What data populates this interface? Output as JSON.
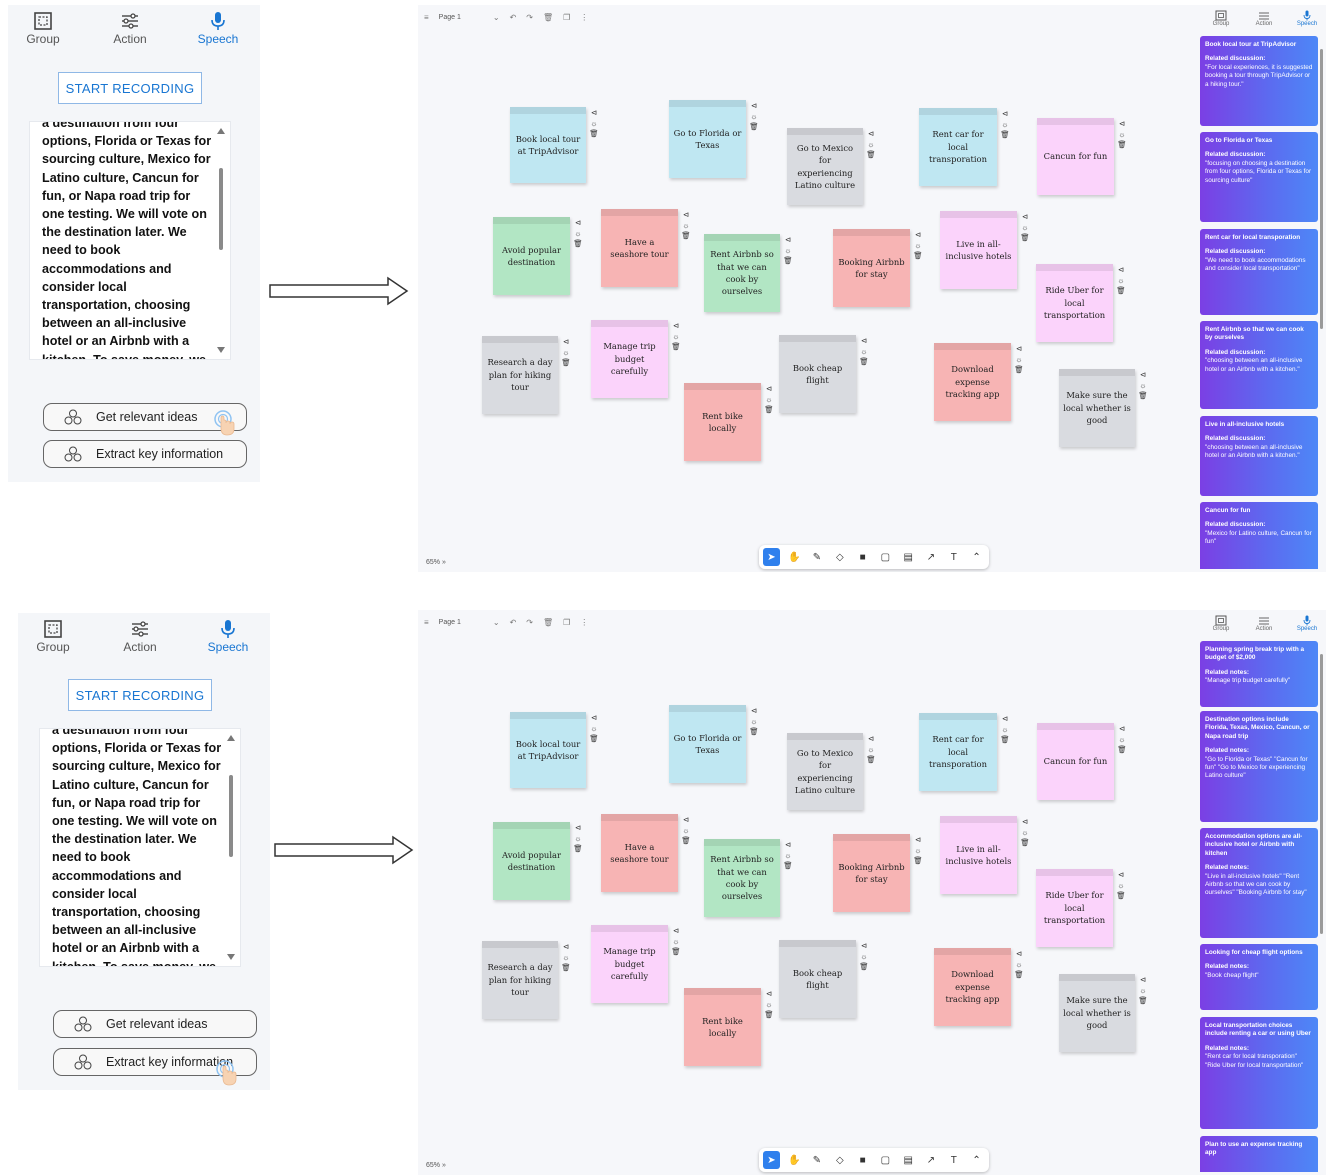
{
  "panels": [
    {
      "tabs": [
        {
          "label": "Group",
          "icon": "group-icon"
        },
        {
          "label": "Action",
          "icon": "sliders-icon"
        },
        {
          "label": "Speech",
          "icon": "microphone-icon"
        }
      ],
      "active_tab": "Speech",
      "record_label": "START RECORDING",
      "transcript": "a destination from four options, Florida or Texas for sourcing culture, Mexico for Latino culture, Cancun for fun, or Napa road trip for one testing. We will vote on the destination later. We need to book accommodations and consider local transportation, choosing between an all-inclusive hotel or an Airbnb with a kitchen. To save money, we",
      "buttons": [
        "Get relevant ideas",
        "Extract key information"
      ],
      "pressed_button": 0
    },
    {
      "tabs": [
        {
          "label": "Group",
          "icon": "group-icon"
        },
        {
          "label": "Action",
          "icon": "sliders-icon"
        },
        {
          "label": "Speech",
          "icon": "microphone-icon"
        }
      ],
      "active_tab": "Speech",
      "record_label": "START RECORDING",
      "transcript": "a destination from four options, Florida or Texas for sourcing culture, Mexico for Latino culture, Cancun for fun, or Napa road trip for one testing. We will vote on the destination later. We need to book accommodations and consider local transportation, choosing between an all-inclusive hotel or an Airbnb with a kitchen. To save money, we",
      "buttons": [
        "Get relevant ideas",
        "Extract key information"
      ],
      "pressed_button": 1
    }
  ],
  "board": {
    "page_label": "Page 1",
    "zoom_label": "65%",
    "toolbar_tools": [
      "select-icon",
      "hand-icon",
      "pen-icon",
      "eraser-icon",
      "sticky-note-icon",
      "shape-icon",
      "frame-icon",
      "arrow-icon",
      "text-icon",
      "chevron-up-icon"
    ],
    "side_tabs": [
      "Group",
      "Action",
      "Speech"
    ],
    "notes": [
      {
        "text": "Book local tour at TripAdvisor",
        "color": "#bfe7f2"
      },
      {
        "text": "Go to Florida or Texas",
        "color": "#bfe7f2"
      },
      {
        "text": "Go to Mexico for experiencing Latino culture",
        "color": "#d9dbe0"
      },
      {
        "text": "Rent car for local transporation",
        "color": "#bfe7f2"
      },
      {
        "text": "Cancun for fun",
        "color": "#fbd3fb"
      },
      {
        "text": "Avoid popular destination",
        "color": "#b2e6c4"
      },
      {
        "text": "Have a seashore tour",
        "color": "#f7b4b4"
      },
      {
        "text": "Rent Airbnb so that we can cook by ourselves",
        "color": "#b2e6c4"
      },
      {
        "text": "Booking Airbnb for stay",
        "color": "#f7b4b4"
      },
      {
        "text": "Live in all-inclusive hotels",
        "color": "#fbd3fb"
      },
      {
        "text": "Ride Uber for local transportation",
        "color": "#fbd3fb"
      },
      {
        "text": "Research a day plan for hiking tour",
        "color": "#d9dbe0"
      },
      {
        "text": "Manage trip budget carefully",
        "color": "#fbd3fb"
      },
      {
        "text": "Book cheap flight",
        "color": "#d9dbe0"
      },
      {
        "text": "Rent bike locally",
        "color": "#f7b4b4"
      },
      {
        "text": "Download expense tracking app",
        "color": "#f7b4b4"
      },
      {
        "text": "Make sure the local whether is good",
        "color": "#d9dbe0"
      }
    ]
  },
  "cards_top": [
    {
      "title": "Book local tour at TripAdvisor",
      "label": "Related discussion:",
      "body": "\"For local experiences, it is suggested booking a tour through TripAdvisor or a hiking tour.\""
    },
    {
      "title": "Go to Florida or Texas",
      "label": "Related discussion:",
      "body": "\"focusing on choosing a destination from four options, Florida or Texas for sourcing culture\""
    },
    {
      "title": "Rent car for local transporation",
      "label": "Related discussion:",
      "body": "\"We need to book accommodations and consider local transportation\""
    },
    {
      "title": "Rent Airbnb so that we can cook by ourselves",
      "label": "Related discussion:",
      "body": "\"choosing between an all-inclusive hotel or an Airbnb with a kitchen.\""
    },
    {
      "title": "Live in all-inclusive hotels",
      "label": "Related discussion:",
      "body": "\"choosing between an all-inclusive hotel or an Airbnb with a kitchen.\""
    },
    {
      "title": "Cancun for fun",
      "label": "Related discussion:",
      "body": "\"Mexico for Latino culture, Cancun for fun\""
    }
  ],
  "cards_bottom": [
    {
      "title": "Planning spring break trip with a budget of $2,000",
      "label": "Related notes:",
      "body": "\"Manage trip budget carefully\""
    },
    {
      "title": "Destination options include Florida, Texas, Mexico, Cancun, or Napa road trip",
      "label": "Related notes:",
      "body": "\"Go to Florida or Texas\" \"Cancun for fun\" \"Go to Mexico for experiencing Latino culture\""
    },
    {
      "title": "Accommodation options are all-inclusive hotel or Airbnb with kitchen",
      "label": "Related notes:",
      "body": "\"Live in all-inclusive hotels\" \"Rent Airbnb so that we can cook by ourselves\" \"Booking Airbnb for stay\""
    },
    {
      "title": "Looking for cheap flight options",
      "label": "Related notes:",
      "body": "\"Book cheap flight\""
    },
    {
      "title": "Local transportation choices include renting a car or using Uber",
      "label": "Related notes:",
      "body": "\"Rent car for local transporation\" \"Ride Uber for local transportation\""
    },
    {
      "title": "Plan to use an expense tracking app",
      "label": "",
      "body": ""
    }
  ]
}
